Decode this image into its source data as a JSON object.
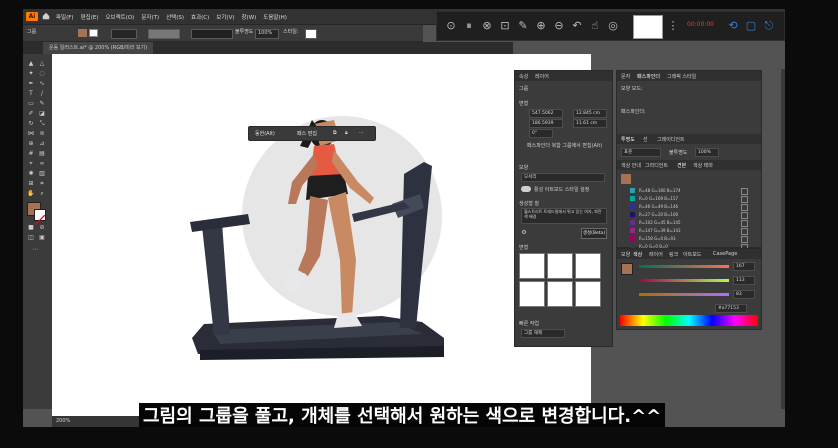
{
  "menubar": {
    "logo": "Ai",
    "items": [
      "파일(F)",
      "편집(E)",
      "오브젝트(O)",
      "문자(T)",
      "선택(S)",
      "효과(C)",
      "보기(V)",
      "창(W)",
      "도움말(H)"
    ]
  },
  "control_bar": {
    "label": "그룹",
    "opacity_label": "불투명도",
    "opacity_value": "100%",
    "style_label": "스타일:"
  },
  "document_tab": {
    "title": "운동 일러스트.ai* @ 200% (RGB/미리 보기)"
  },
  "float_toolbar": {
    "ungroup_label": "동한(Alt)",
    "path_edit_label": "패스 편집"
  },
  "recorder": {
    "record_label": "00:00:00"
  },
  "properties_panel": {
    "tabs": [
      "속성",
      "레이어"
    ],
    "section_group": "그룹",
    "section_transform": "변형",
    "x_value": "547.5062",
    "y_value": "186.5939",
    "w_value": "12.845 cm",
    "h_value": "11.61 cm",
    "angle_value": "0°",
    "hint_text": "패스파인더 복합 그룹에서 편집(Alt)",
    "section_appearance": "모양",
    "appearance_item": "모서리",
    "toggle_label": "활성 아트보드 스타일 설정",
    "section_gen": "생성형 칠",
    "gen_prompt": "월스트리트 트래드밀에서 뛰고 있는 여자, 파란 색 배경",
    "gen_button": "생성(Beta)",
    "section_variations": "변형",
    "section_quick": "빠른 작업",
    "quick_item": "그룹 해제"
  },
  "swatches_panel": {
    "tabs": [
      "문자",
      "패스파인더",
      "그래픽 스타일"
    ],
    "section_shape": "모양 모드:",
    "section_pathfinder": "패스파인더:",
    "stroke_tabs": [
      "투명도",
      "선",
      "그레이디언트"
    ],
    "blend_mode": "표준",
    "opacity_label": "불투명도",
    "opacity_value": "100%",
    "color_tabs": [
      "색상 안내",
      "그라디언트",
      "견본",
      "색상 테마"
    ],
    "swatches": [
      {
        "name": "R=48 G=160 B=174",
        "color": "#30a0ae"
      },
      {
        "name": "R=0 G=169 B=157",
        "color": "#00a99d"
      },
      {
        "name": "R=46 G=49 B=146",
        "color": "#2e3192"
      },
      {
        "name": "R=27 G=20 B=100",
        "color": "#1b1464"
      },
      {
        "name": "R=102 G=45 B=145",
        "color": "#662d91"
      },
      {
        "name": "R=147 G=39 B=143",
        "color": "#93278f"
      },
      {
        "name": "R=158 G=0 B=93",
        "color": "#9e005d"
      },
      {
        "name": "R=0 G=0 B=0",
        "color": "#3a3a3a"
      }
    ]
  },
  "color_panel": {
    "tabs": [
      "모양",
      "색상",
      "레이어",
      "링크",
      "아트보드",
      "CasePage"
    ],
    "r_value": "167",
    "g_value": "113",
    "b_value": "83",
    "hex_value": "#a77153",
    "fill_color": "#a77153"
  },
  "statusbar": {
    "zoom": "200%"
  },
  "caption": "그림의 그룹을 풀고, 개체를 선택해서 원하는 색으로 변경합니다.^^"
}
